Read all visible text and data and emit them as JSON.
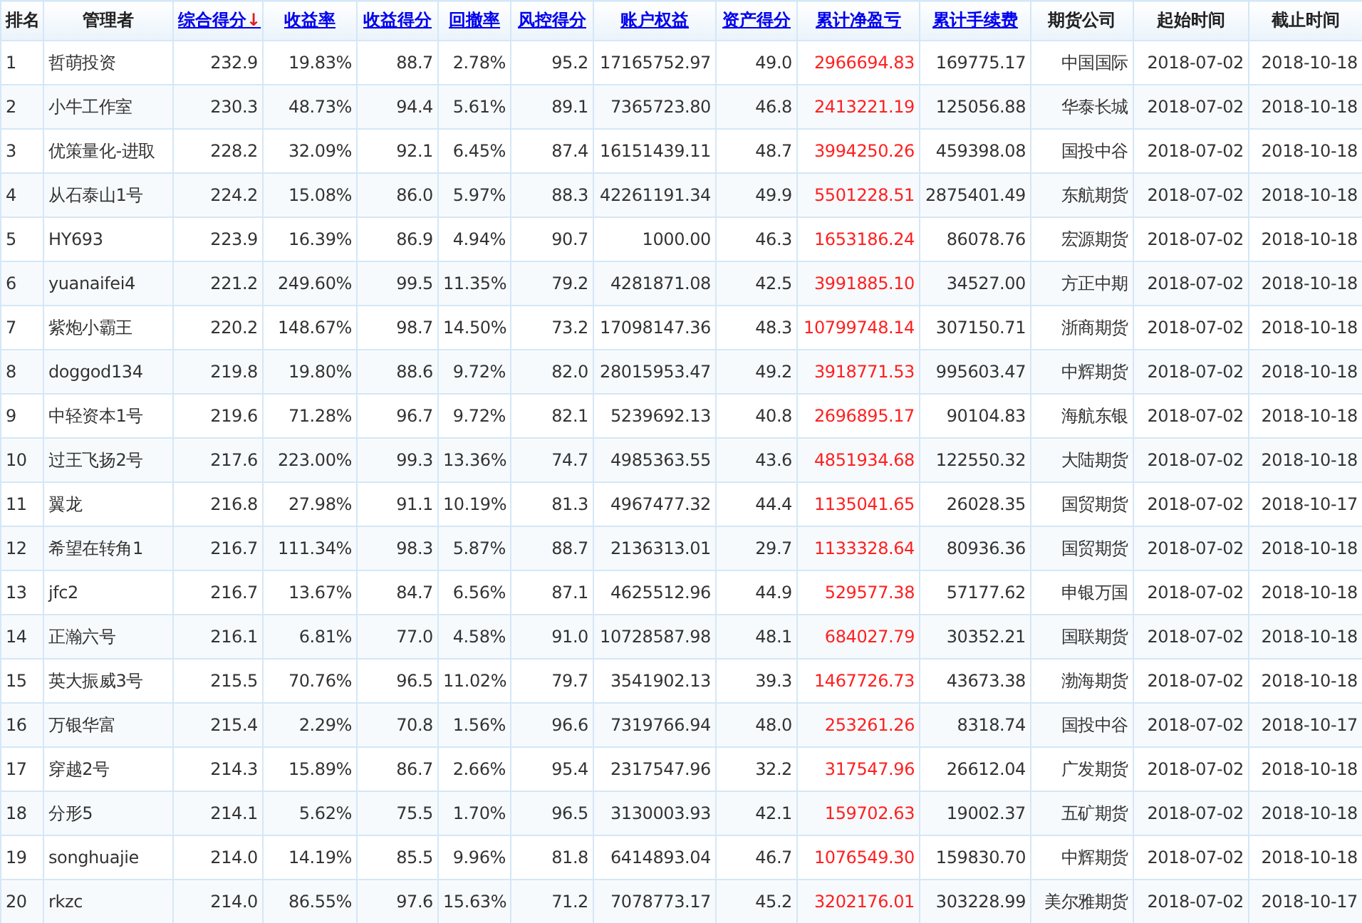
{
  "table": {
    "columns": [
      {
        "label": "排名",
        "kind": "plain"
      },
      {
        "label": "管理者",
        "kind": "plain"
      },
      {
        "label": "综合得分",
        "kind": "sortable",
        "sort_mark": "↓"
      },
      {
        "label": "收益率",
        "kind": "sortable"
      },
      {
        "label": "收益得分",
        "kind": "sortable"
      },
      {
        "label": "回撤率",
        "kind": "sortable"
      },
      {
        "label": "风控得分",
        "kind": "sortable"
      },
      {
        "label": "账户权益",
        "kind": "sortable"
      },
      {
        "label": "资产得分",
        "kind": "sortable"
      },
      {
        "label": "累计净盈亏",
        "kind": "sortable",
        "emphasis": true
      },
      {
        "label": "累计手续费",
        "kind": "sortable"
      },
      {
        "label": "期货公司",
        "kind": "plain"
      },
      {
        "label": "起始时间",
        "kind": "plain"
      },
      {
        "label": "截止时间",
        "kind": "plain"
      }
    ],
    "rows": [
      [
        "1",
        "哲萌投资",
        "232.9",
        "19.83%",
        "88.7",
        "2.78%",
        "95.2",
        "17165752.97",
        "49.0",
        "2966694.83",
        "169775.17",
        "中国国际",
        "2018-07-02",
        "2018-10-18"
      ],
      [
        "2",
        "小牛工作室",
        "230.3",
        "48.73%",
        "94.4",
        "5.61%",
        "89.1",
        "7365723.80",
        "46.8",
        "2413221.19",
        "125056.88",
        "华泰长城",
        "2018-07-02",
        "2018-10-18"
      ],
      [
        "3",
        "优策量化-进取",
        "228.2",
        "32.09%",
        "92.1",
        "6.45%",
        "87.4",
        "16151439.11",
        "48.7",
        "3994250.26",
        "459398.08",
        "国投中谷",
        "2018-07-02",
        "2018-10-18"
      ],
      [
        "4",
        "从石泰山1号",
        "224.2",
        "15.08%",
        "86.0",
        "5.97%",
        "88.3",
        "42261191.34",
        "49.9",
        "5501228.51",
        "2875401.49",
        "东航期货",
        "2018-07-02",
        "2018-10-18"
      ],
      [
        "5",
        "HY693",
        "223.9",
        "16.39%",
        "86.9",
        "4.94%",
        "90.7",
        "1000.00",
        "46.3",
        "1653186.24",
        "86078.76",
        "宏源期货",
        "2018-07-02",
        "2018-10-18"
      ],
      [
        "6",
        "yuanaifei4",
        "221.2",
        "249.60%",
        "99.5",
        "11.35%",
        "79.2",
        "4281871.08",
        "42.5",
        "3991885.10",
        "34527.00",
        "方正中期",
        "2018-07-02",
        "2018-10-18"
      ],
      [
        "7",
        "紫炮小霸王",
        "220.2",
        "148.67%",
        "98.7",
        "14.50%",
        "73.2",
        "17098147.36",
        "48.3",
        "10799748.14",
        "307150.71",
        "浙商期货",
        "2018-07-02",
        "2018-10-18"
      ],
      [
        "8",
        "doggod134",
        "219.8",
        "19.80%",
        "88.6",
        "9.72%",
        "82.0",
        "28015953.47",
        "49.2",
        "3918771.53",
        "995603.47",
        "中辉期货",
        "2018-07-02",
        "2018-10-18"
      ],
      [
        "9",
        "中轻资本1号",
        "219.6",
        "71.28%",
        "96.7",
        "9.72%",
        "82.1",
        "5239692.13",
        "40.8",
        "2696895.17",
        "90104.83",
        "海航东银",
        "2018-07-02",
        "2018-10-18"
      ],
      [
        "10",
        "过王飞扬2号",
        "217.6",
        "223.00%",
        "99.3",
        "13.36%",
        "74.7",
        "4985363.55",
        "43.6",
        "4851934.68",
        "122550.32",
        "大陆期货",
        "2018-07-02",
        "2018-10-18"
      ],
      [
        "11",
        "翼龙",
        "216.8",
        "27.98%",
        "91.1",
        "10.19%",
        "81.3",
        "4967477.32",
        "44.4",
        "1135041.65",
        "26028.35",
        "国贸期货",
        "2018-07-02",
        "2018-10-17"
      ],
      [
        "12",
        "希望在转角1",
        "216.7",
        "111.34%",
        "98.3",
        "5.87%",
        "88.7",
        "2136313.01",
        "29.7",
        "1133328.64",
        "80936.36",
        "国贸期货",
        "2018-07-02",
        "2018-10-18"
      ],
      [
        "13",
        "jfc2",
        "216.7",
        "13.67%",
        "84.7",
        "6.56%",
        "87.1",
        "4625512.96",
        "44.9",
        "529577.38",
        "57177.62",
        "申银万国",
        "2018-07-02",
        "2018-10-18"
      ],
      [
        "14",
        "正瀚六号",
        "216.1",
        "6.81%",
        "77.0",
        "4.58%",
        "91.0",
        "10728587.98",
        "48.1",
        "684027.79",
        "30352.21",
        "国联期货",
        "2018-07-02",
        "2018-10-18"
      ],
      [
        "15",
        "英大振威3号",
        "215.5",
        "70.76%",
        "96.5",
        "11.02%",
        "79.7",
        "3541902.13",
        "39.3",
        "1467726.73",
        "43673.38",
        "渤海期货",
        "2018-07-02",
        "2018-10-18"
      ],
      [
        "16",
        "万银华富",
        "215.4",
        "2.29%",
        "70.8",
        "1.56%",
        "96.6",
        "7319766.94",
        "48.0",
        "253261.26",
        "8318.74",
        "国投中谷",
        "2018-07-02",
        "2018-10-17"
      ],
      [
        "17",
        "穿越2号",
        "214.3",
        "15.89%",
        "86.7",
        "2.66%",
        "95.4",
        "2317547.96",
        "32.2",
        "317547.96",
        "26612.04",
        "广发期货",
        "2018-07-02",
        "2018-10-18"
      ],
      [
        "18",
        "分形5",
        "214.1",
        "5.62%",
        "75.5",
        "1.70%",
        "96.5",
        "3130003.93",
        "42.1",
        "159702.63",
        "19002.37",
        "五矿期货",
        "2018-07-02",
        "2018-10-18"
      ],
      [
        "19",
        "songhuajie",
        "214.0",
        "14.19%",
        "85.5",
        "9.96%",
        "81.8",
        "6414893.04",
        "46.7",
        "1076549.30",
        "159830.70",
        "中辉期货",
        "2018-07-02",
        "2018-10-18"
      ],
      [
        "20",
        "rkzc",
        "214.0",
        "86.55%",
        "97.6",
        "15.63%",
        "71.2",
        "7078773.17",
        "45.2",
        "3202176.01",
        "303228.99",
        "美尔雅期货",
        "2018-07-02",
        "2018-10-17"
      ]
    ]
  }
}
